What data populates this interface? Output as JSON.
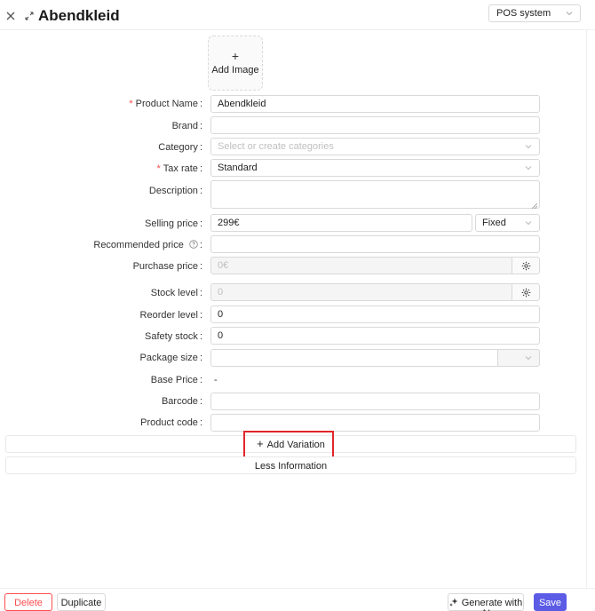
{
  "header": {
    "title": "Abendkleid",
    "channel_select": "POS system"
  },
  "upload": {
    "plus": "+",
    "label": "Add Image"
  },
  "form": {
    "product_name": {
      "label": "Product Name",
      "value": "Abendkleid",
      "required": true
    },
    "brand": {
      "label": "Brand",
      "value": ""
    },
    "category": {
      "label": "Category",
      "placeholder": "Select or create categories"
    },
    "tax_rate": {
      "label": "Tax rate",
      "value": "Standard",
      "required": true
    },
    "description": {
      "label": "Description",
      "value": ""
    },
    "selling_price": {
      "label": "Selling price",
      "value": "299€",
      "type": "Fixed"
    },
    "recommended_price": {
      "label": "Recommended price",
      "value": ""
    },
    "purchase_price": {
      "label": "Purchase price",
      "placeholder": "0€"
    },
    "stock_level": {
      "label": "Stock level",
      "placeholder": "0"
    },
    "reorder_level": {
      "label": "Reorder level",
      "value": "0"
    },
    "safety_stock": {
      "label": "Safety stock",
      "value": "0"
    },
    "package_size": {
      "label": "Package size",
      "value": ""
    },
    "base_price": {
      "label": "Base Price",
      "value": "-"
    },
    "barcode": {
      "label": "Barcode",
      "value": ""
    },
    "product_code": {
      "label": "Product code",
      "value": ""
    }
  },
  "actions": {
    "add_variation": "Add Variation",
    "less_information": "Less Information"
  },
  "footer": {
    "delete": "Delete",
    "duplicate": "Duplicate",
    "generate_ai": "Generate with AI",
    "save": "Save"
  },
  "colors": {
    "accent": "#5b5be6",
    "danger": "#ff4d4f",
    "highlight": "#e0262b"
  }
}
